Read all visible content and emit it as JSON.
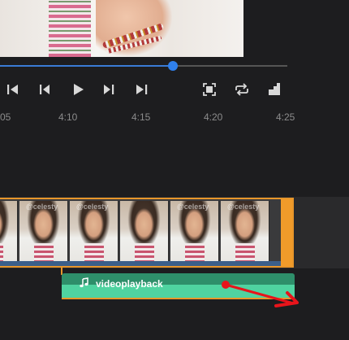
{
  "preview": {
    "icon": "video-frame"
  },
  "player": {
    "progress": 0.6,
    "controls": [
      {
        "name": "skip-back-icon"
      },
      {
        "name": "frame-back-icon"
      },
      {
        "name": "play-icon"
      },
      {
        "name": "frame-forward-icon"
      },
      {
        "name": "skip-forward-icon"
      },
      {
        "name": "fullscreen-icon"
      },
      {
        "name": "loop-icon"
      },
      {
        "name": "volume-icon"
      }
    ]
  },
  "ruler": {
    "labels": [
      "05",
      "4:10",
      "4:15",
      "4:20",
      "4:25"
    ]
  },
  "timeline": {
    "video_clip": {
      "thumbnail_logo": "@celesty",
      "accent": "#f09b2a"
    },
    "audio_clip": {
      "title": "videoplayback",
      "color": "#2e8f6a",
      "icon": "music-note-icon"
    }
  },
  "annotation": {
    "color": "#e8141b"
  }
}
